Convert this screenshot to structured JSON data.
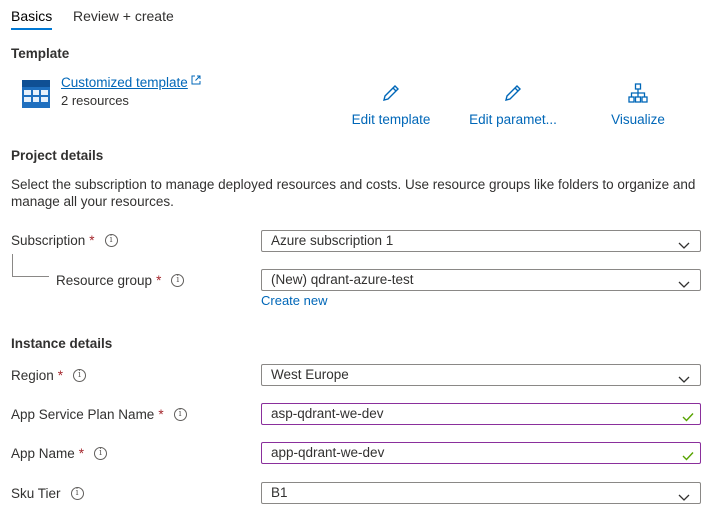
{
  "tabs": [
    {
      "label": "Basics"
    },
    {
      "label": "Review + create"
    }
  ],
  "template_section": {
    "title": "Template",
    "template_link": "Customized template",
    "resources": "2 resources",
    "actions": {
      "edit_template": "Edit template",
      "edit_parameters": "Edit paramet...",
      "visualize": "Visualize"
    }
  },
  "project_details": {
    "title": "Project details",
    "description": "Select the subscription to manage deployed resources and costs. Use resource groups like folders to organize and manage all your resources.",
    "subscription": {
      "label": "Subscription",
      "value": "Azure subscription 1"
    },
    "resource_group": {
      "label": "Resource group",
      "value": "(New) qdrant-azure-test",
      "create_new": "Create new"
    }
  },
  "instance_details": {
    "title": "Instance details",
    "region": {
      "label": "Region",
      "value": "West Europe"
    },
    "plan_name": {
      "label": "App Service Plan Name",
      "value": "asp-qdrant-we-dev"
    },
    "app_name": {
      "label": "App Name",
      "value": "app-qdrant-we-dev"
    },
    "sku_tier": {
      "label": "Sku Tier",
      "value": "B1"
    }
  },
  "colors": {
    "accent": "#0078d4",
    "link": "#0067b8",
    "required": "#a4262c",
    "valid_border": "#8a2f9c",
    "valid_check": "#57a300"
  },
  "icons": {
    "template": "template-grid-icon",
    "external": "external-link-icon",
    "edit": "pencil-icon",
    "visualize": "hierarchy-icon",
    "info": "info-icon",
    "dropdown": "chevron-down-icon",
    "valid": "checkmark-icon"
  }
}
